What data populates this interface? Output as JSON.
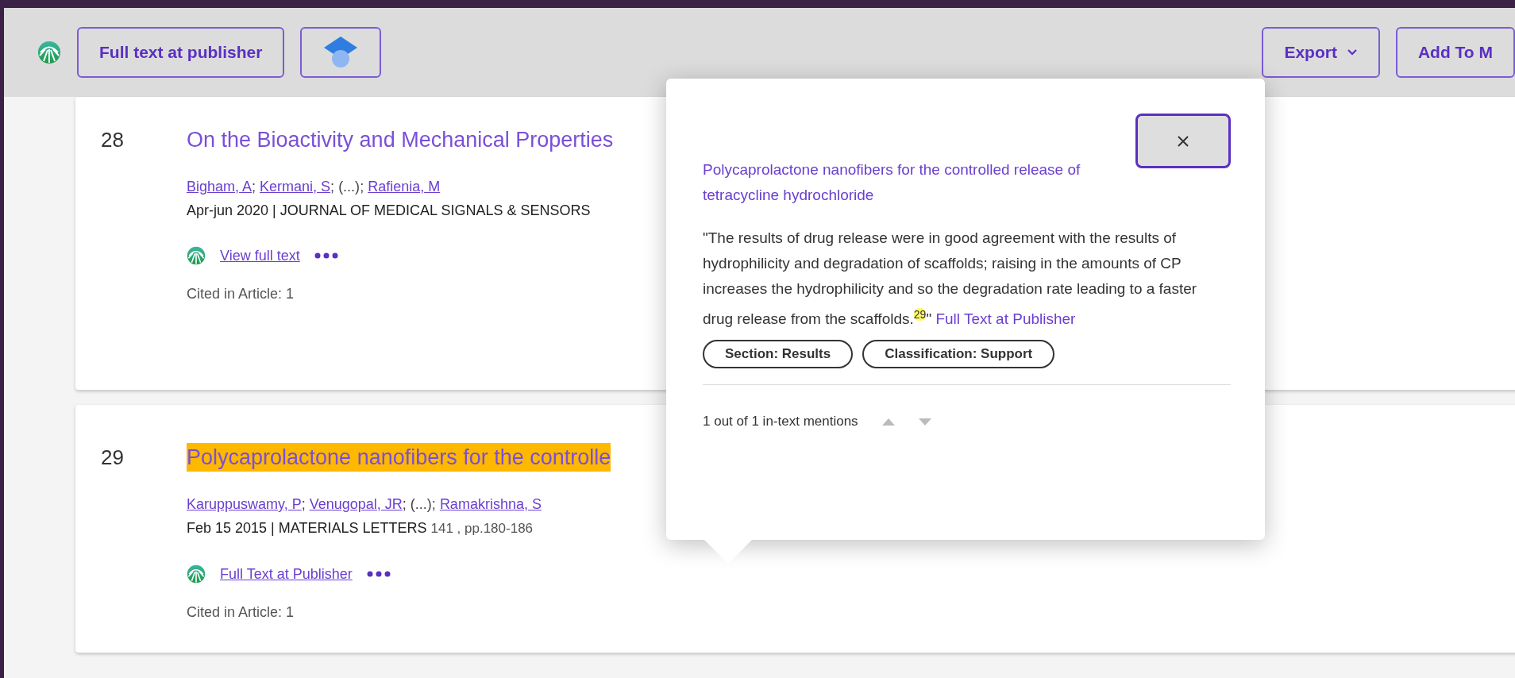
{
  "toolbar": {
    "buttons": [
      {
        "kind": "text",
        "label": "Full text at publisher"
      },
      {
        "kind": "icon"
      }
    ],
    "right_buttons": [
      {
        "label": "Export",
        "dropdown": true
      },
      {
        "label": "Add To M",
        "dropdown": false
      }
    ]
  },
  "results": [
    {
      "number": "28",
      "title": "On the Bioactivity and Mechanical Properties",
      "highlighted": false,
      "separator": "; ",
      "authors": [
        {
          "kind": "link",
          "text": "Bigham, A"
        },
        {
          "kind": "link",
          "text": "Kermani, S"
        },
        {
          "kind": "text",
          "text": "(...)"
        },
        {
          "kind": "link",
          "text": "Rafienia, M"
        }
      ],
      "source": "Apr-jun 2020 | JOURNAL OF MEDICAL SIGNALS & SENSORS",
      "link_label": "View full text",
      "cited": "Cited in Article: 1"
    },
    {
      "number": "29",
      "title": "Polycaprolactone nanofibers for the controlle",
      "highlighted": true,
      "separator": "; ",
      "authors": [
        {
          "kind": "link",
          "text": "Karuppuswamy, P"
        },
        {
          "kind": "link",
          "text": "Venugopal, JR"
        },
        {
          "kind": "text",
          "text": "(...)"
        },
        {
          "kind": "link",
          "text": "Ramakrishna, S"
        }
      ],
      "source": "Feb 15 2015 | MATERIALS LETTERS",
      "source_detail": "141 , pp.180-186",
      "link_label": "Full Text at Publisher",
      "cited": "Cited in Article: 1"
    }
  ],
  "popup": {
    "title": "Polycaprolactone nanofibers for the controlled release of tetracycline hydrochloride",
    "quote": "\"The results of drug release were in good agreement with the results of hydrophilicity and degradation of scaffolds; raising in the amounts of CP increases the hydrophilicity and so the degradation rate leading to a faster drug release from the scaffolds.",
    "footnote": "29",
    "quote_end": "\"",
    "quote_link": "Full Text at Publisher",
    "tags": [
      "Section: Results",
      "Classification: Support"
    ],
    "mentions": "1 out of 1 in-text mentions"
  }
}
